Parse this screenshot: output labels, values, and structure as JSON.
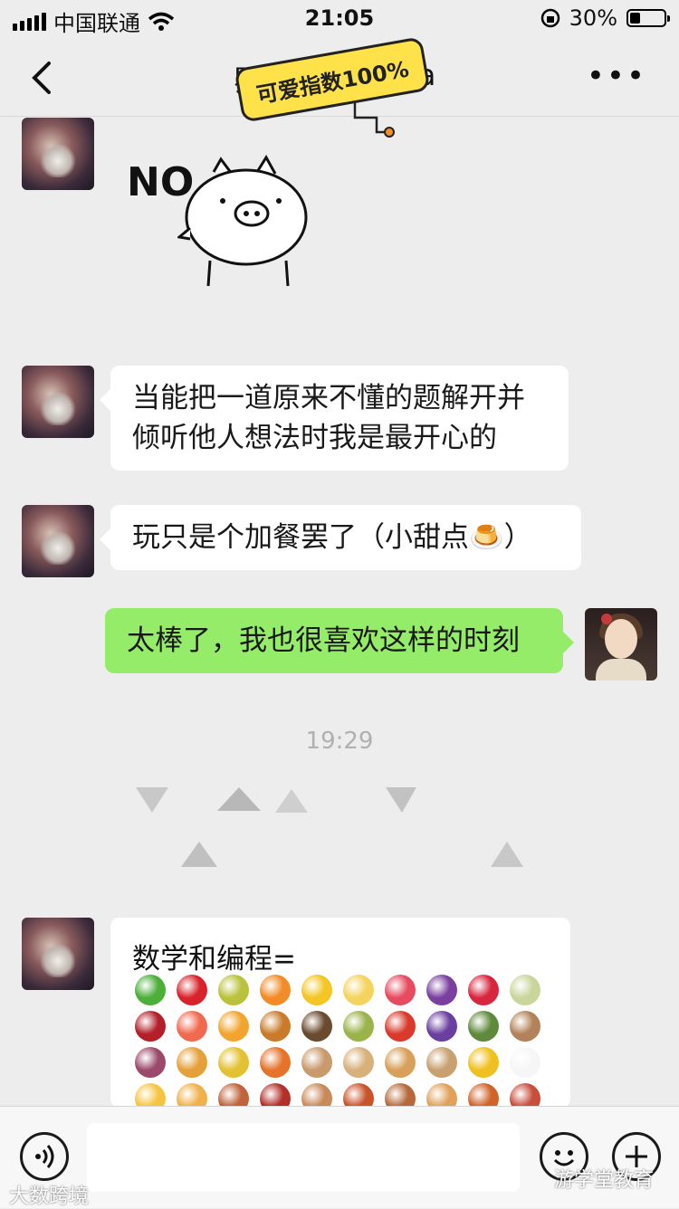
{
  "status_bar": {
    "carrier": "中国联通",
    "time": "21:05",
    "battery": "30%",
    "battery_level": 0.3
  },
  "nav": {
    "title_visible": "罢",
    "title_tail": "ea",
    "sticker_text": "可爱指数100%"
  },
  "messages": {
    "sticker_text": "NO",
    "msg1_line1": "当能把一道原来不懂的题解开并",
    "msg1_line2": "倾听他人想法时我是最开心的",
    "msg2": "玩只是个加餐罢了（小甜点🍮）",
    "msg3": "太棒了，我也很喜欢这样的时刻",
    "timestamp": "19:29",
    "msg4_text": "数学和编程="
  },
  "watermarks": {
    "bottom_left": "大数跨境",
    "bottom_right": "游学堂教育"
  },
  "food_colors": [
    "#4caf3a",
    "#d8232a",
    "#b9c23a",
    "#f28c28",
    "#f3c623",
    "#f4d35e",
    "#e84a5f",
    "#7b3fa0",
    "#d7263d",
    "#c8d69c",
    "#b3202a",
    "#f1694f",
    "#f2a52e",
    "#c97b2a",
    "#6a4b2f",
    "#9ab34a",
    "#d93a2b",
    "#6b3fa0",
    "#5f8a3c",
    "#b3825a",
    "#9c4a6b",
    "#e6a03a",
    "#e3c132",
    "#e5742a",
    "#c99a6d",
    "#d8b07a",
    "#d8a05a",
    "#c9a070",
    "#f0c020",
    "#f6f6f6",
    "#f5c542",
    "#f0b14a",
    "#c0633a",
    "#b3302a",
    "#c98a5a",
    "#c9542a",
    "#b66a3a",
    "#e0a25a",
    "#d0642a",
    "#c84d3a",
    "#f0b030",
    "#4d8a3a"
  ]
}
